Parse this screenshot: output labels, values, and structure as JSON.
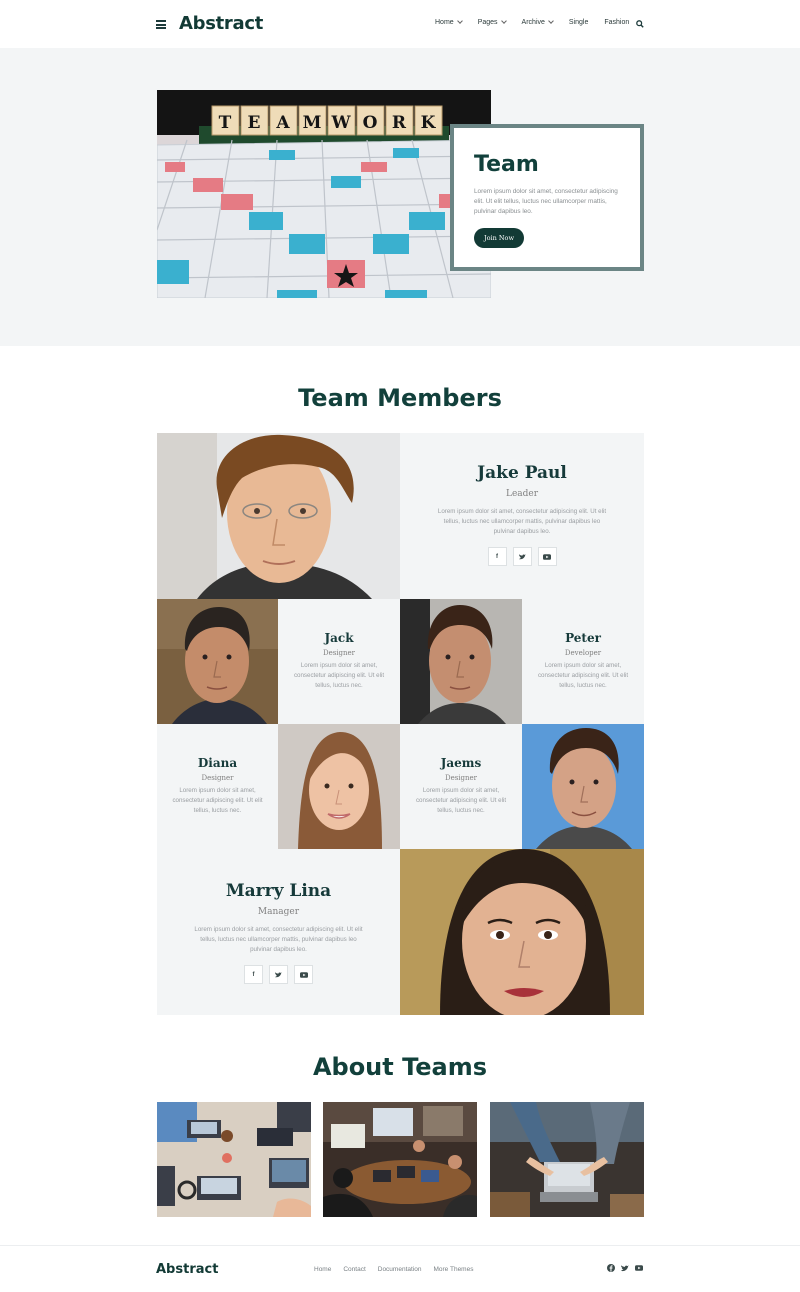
{
  "header": {
    "logo": "Abstract",
    "nav": [
      {
        "label": "Home",
        "has_dropdown": true
      },
      {
        "label": "Pages",
        "has_dropdown": true
      },
      {
        "label": "Archive",
        "has_dropdown": true
      },
      {
        "label": "Single",
        "has_dropdown": false
      },
      {
        "label": "Fashion",
        "has_dropdown": false
      }
    ],
    "icons": {
      "menu": "hamburger-icon",
      "search": "search-icon"
    }
  },
  "hero": {
    "image_text": "TEAMWORK",
    "title": "Team",
    "text": "Lorem ipsum dolor sit amet, consectetur adipiscing elit. Ut elit tellus, luctus nec ullamcorper mattis, pulvinar dapibus leo.",
    "button": "Join Now"
  },
  "team_section": {
    "title": "Team Members",
    "members": [
      {
        "name": "Jake Paul",
        "role": "Leader",
        "text": "Lorem ipsum dolor sit amet, consectetur adipiscing elit. Ut elit tellus, luctus nec ullamcorper mattis, pulvinar dapibus leo pulvinar dapibus leo."
      },
      {
        "name": "Jack",
        "role": "Designer",
        "text": "Lorem ipsum dolor sit amet, consectetur adipiscing elit. Ut elit tellus, luctus nec."
      },
      {
        "name": "Peter",
        "role": "Developer",
        "text": "Lorem ipsum dolor sit amet, consectetur adipiscing elit. Ut elit tellus, luctus nec."
      },
      {
        "name": "Diana",
        "role": "Designer",
        "text": "Lorem ipsum dolor sit amet, consectetur adipiscing elit. Ut elit tellus, luctus nec."
      },
      {
        "name": "Jaems",
        "role": "Designer",
        "text": "Lorem ipsum dolor sit amet, consectetur adipiscing elit. Ut elit tellus, luctus nec."
      },
      {
        "name": "Marry Lina",
        "role": "Manager",
        "text": "Lorem ipsum dolor sit amet, consectetur adipiscing elit. Ut elit tellus, luctus nec ullamcorper mattis, pulvinar dapibus leo pulvinar dapibus leo."
      }
    ],
    "social_icons": [
      "facebook-icon",
      "twitter-icon",
      "youtube-icon"
    ]
  },
  "about_section": {
    "title": "About Teams"
  },
  "footer": {
    "logo": "Abstract",
    "links": [
      "Home",
      "Contact",
      "Documentation",
      "More Themes"
    ],
    "social_icons": [
      "facebook-icon",
      "twitter-icon",
      "youtube-icon"
    ]
  },
  "colors": {
    "brand_dark": "#123a35",
    "card_border": "#6b8585",
    "section_bg": "#f3f5f6"
  }
}
